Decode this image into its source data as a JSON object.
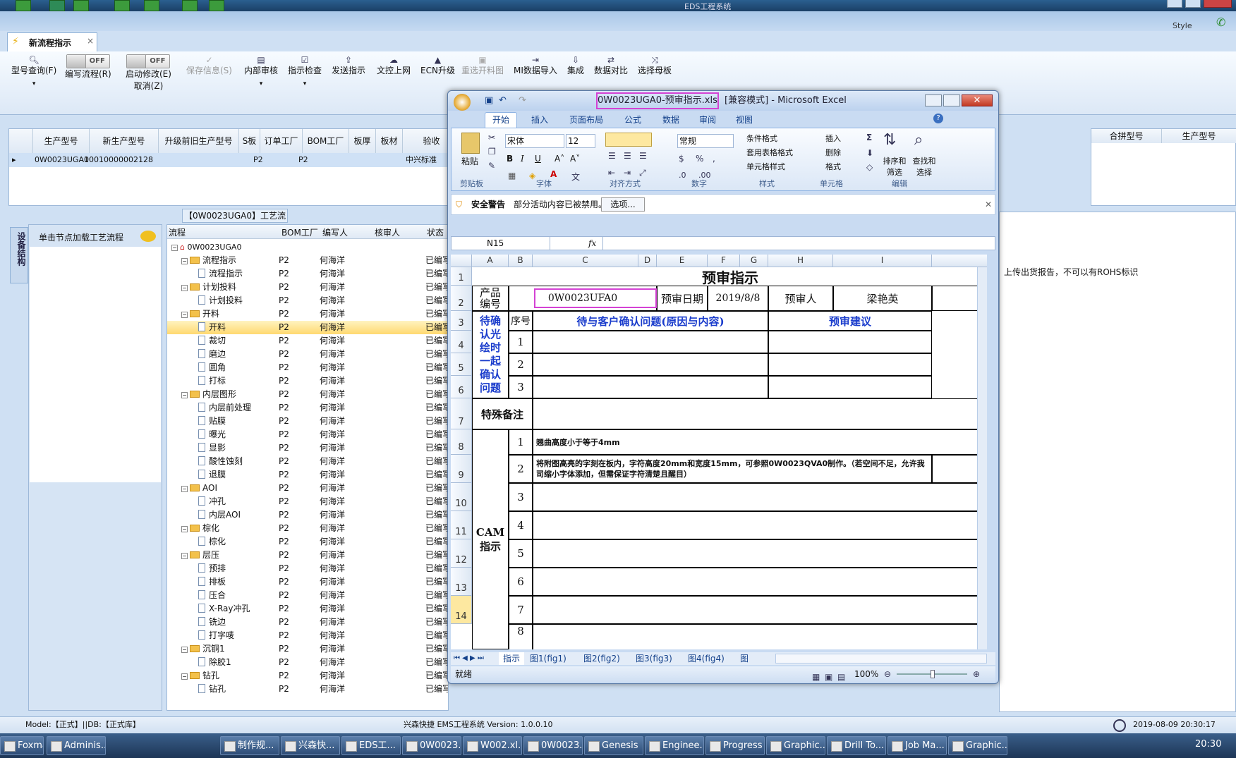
{
  "system_title": "EDS工程系统",
  "top_right": {
    "style": "Style"
  },
  "doc_tab": {
    "label": "新流程指示",
    "close": "×"
  },
  "ribbon": {
    "model_query": "型号查询(F)",
    "edit_flow": "编写流程(R)",
    "start_modify": "启动修改(E)",
    "cancel": "取消(Z)",
    "toggle_off": "OFF",
    "save_info": "保存信息(S)",
    "internal_review": "内部审核",
    "instruction_check": "指示检查",
    "send_instruction": "发送指示",
    "upload_web": "文控上网",
    "ecn_upgrade": "ECN升级",
    "reselect_cut": "重选开料图",
    "mi_import": "MI数据导入",
    "integrate": "集成",
    "data_compare": "数据对比",
    "select_master": "选择母板"
  },
  "grid": {
    "headers": [
      "生产型号",
      "新生产型号",
      "升级前旧生产型号",
      "S板",
      "订单工厂",
      "BOM工厂",
      "板厚",
      "板材",
      "验收"
    ],
    "row": [
      "0W0023UGA0",
      "10010000002128",
      "",
      "",
      "P2",
      "P2",
      "",
      "",
      "中兴标准"
    ]
  },
  "right_grid": {
    "headers": [
      "合拼型号",
      "生产型号"
    ]
  },
  "process_title": "【0W0023UGA0】工艺流程",
  "left_tab": "设备结构",
  "left_panel_hint": "单击节点加载工艺流程",
  "tree": {
    "headers": [
      "流程",
      "BOM工厂",
      "编写人",
      "核审人",
      "状态"
    ],
    "root": "0W0023UGA0",
    "factory": "P2",
    "author": "何海洋",
    "status": "已编写",
    "rows": [
      {
        "name": "流程指示",
        "type": "folder"
      },
      {
        "name": "流程指示",
        "type": "doc"
      },
      {
        "name": "计划投料",
        "type": "folder"
      },
      {
        "name": "计划投料",
        "type": "doc"
      },
      {
        "name": "开料",
        "type": "folder"
      },
      {
        "name": "开料",
        "type": "doc",
        "selected": true
      },
      {
        "name": "裁切",
        "type": "doc"
      },
      {
        "name": "磨边",
        "type": "doc"
      },
      {
        "name": "圆角",
        "type": "doc"
      },
      {
        "name": "打标",
        "type": "doc"
      },
      {
        "name": "内层图形",
        "type": "folder"
      },
      {
        "name": "内层前处理",
        "type": "doc"
      },
      {
        "name": "贴膜",
        "type": "doc"
      },
      {
        "name": "曝光",
        "type": "doc"
      },
      {
        "name": "显影",
        "type": "doc"
      },
      {
        "name": "酸性蚀刻",
        "type": "doc"
      },
      {
        "name": "退膜",
        "type": "doc"
      },
      {
        "name": "AOI",
        "type": "folder"
      },
      {
        "name": "冲孔",
        "type": "doc"
      },
      {
        "name": "内层AOI",
        "type": "doc"
      },
      {
        "name": "棕化",
        "type": "folder"
      },
      {
        "name": "棕化",
        "type": "doc"
      },
      {
        "name": "层压",
        "type": "folder"
      },
      {
        "name": "预排",
        "type": "doc"
      },
      {
        "name": "排板",
        "type": "doc"
      },
      {
        "name": "压合",
        "type": "doc"
      },
      {
        "name": "X-Ray冲孔",
        "type": "doc"
      },
      {
        "name": "铣边",
        "type": "doc"
      },
      {
        "name": "打字唛",
        "type": "doc"
      },
      {
        "name": "沉铜1",
        "type": "folder"
      },
      {
        "name": "除胶1",
        "type": "doc"
      },
      {
        "name": "钻孔",
        "type": "folder"
      },
      {
        "name": "钻孔",
        "type": "doc"
      }
    ]
  },
  "right_note": "上传出货报告，不可以有ROHS标识",
  "status_bar": {
    "model": "Model:【正式】||DB:【正式库】",
    "center": "兴森快捷 EMS工程系统 Version: 1.0.0.10",
    "time": "2019-08-09 20:30:17"
  },
  "taskbar": {
    "items": [
      "Foxmail",
      "Adminis...",
      "制作规...",
      "兴森快...",
      "EDS工...",
      "0W0023...",
      "W002.xl...",
      "0W0023...",
      "Genesis",
      "Enginee...",
      "Progress",
      "Graphic...",
      "Drill To...",
      "Job Ma...",
      "Graphic..."
    ],
    "clock": "20:30"
  },
  "excel": {
    "title_file": "0W0023UGA0-预审指示.xls",
    "title_rest": "[兼容模式] - Microsoft Excel",
    "tabs": [
      "开始",
      "插入",
      "页面布局",
      "公式",
      "数据",
      "审阅",
      "视图"
    ],
    "paste": "粘贴",
    "font_name": "宋体",
    "font_size": "12",
    "number_format": "常规",
    "cond_format": "条件格式",
    "table_format": "套用表格格式",
    "cell_style": "单元格样式",
    "insert": "插入",
    "delete": "删除",
    "format": "格式",
    "sort_filter": "排序和筛选",
    "find_select": "查找和选择",
    "groups": [
      "剪贴板",
      "字体",
      "对齐方式",
      "数字",
      "样式",
      "单元格",
      "编辑"
    ],
    "security_warning": "安全警告",
    "warning_msg": "部分活动内容已被禁用。",
    "options_btn": "选项...",
    "name_box": "N15",
    "fx": "fx",
    "col_headers": [
      "A",
      "B",
      "C",
      "D",
      "E",
      "F",
      "G",
      "H",
      "I"
    ],
    "row_headers": [
      "1",
      "2",
      "3",
      "4",
      "5",
      "6",
      "7",
      "8",
      "9",
      "10",
      "11",
      "12",
      "13",
      "14"
    ],
    "sheet": {
      "title": "预审指示",
      "product_no_label": "产品编号",
      "product_no": "0W0023UFA0",
      "review_date_label": "预审日期",
      "review_date": "2019/8/8",
      "reviewer_label": "预审人",
      "reviewer": "梁艳英",
      "seq": "序号",
      "issue_header": "待与客户确认问题(原因与内容)",
      "suggest_header": "预审建议",
      "pending_label": "待确认光绘时一起确认问题",
      "special_label": "特殊备注",
      "cam_label": "CAM指示",
      "n1": "1",
      "n2": "2",
      "n3": "3",
      "n4": "4",
      "n5": "5",
      "n6": "6",
      "n7": "7",
      "n8": "8",
      "cam1": "翘曲高度小于等于4mm",
      "cam2": "将附图高亮的字刻在板内，字符高度20mm和宽度15mm，可参照0W0023QVA0制作。（若空间不足，允许我司缩小字体添加，但需保证字符清楚且醒目）"
    },
    "sheet_tabs": [
      "指示",
      "图1(fig1)",
      "图2(fig2)",
      "图3(fig3)",
      "图4(fig4)",
      "图"
    ],
    "ready": "就绪",
    "zoom": "100%"
  }
}
